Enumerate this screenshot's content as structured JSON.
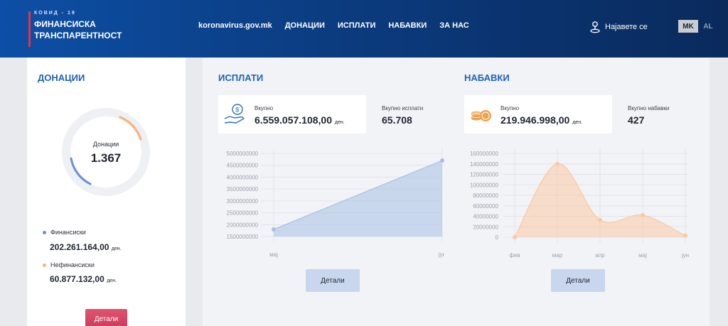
{
  "brand": {
    "subtitle": "КОВИД - 19",
    "line1": "ФИНАНСИСКА",
    "line2": "ТРАНСПАРЕНТНОСТ"
  },
  "nav": [
    {
      "label": "koronavirus.gov.mk"
    },
    {
      "label": "ДОНАЦИИ"
    },
    {
      "label": "ИСПЛАТИ"
    },
    {
      "label": "НАБАВКИ"
    },
    {
      "label": "ЗА НАС"
    }
  ],
  "login": {
    "label": "Најавете се",
    "icon": "user-pin-icon"
  },
  "languages": [
    {
      "code": "MK",
      "active": true
    },
    {
      "code": "AL",
      "active": false
    }
  ],
  "donations": {
    "title": "ДОНАЦИИ",
    "center_label": "Донации",
    "center_value": "1.367",
    "legend": [
      {
        "label": "Финансиски",
        "amount": "202.261.164,00",
        "currency": "ден.",
        "color": "#6a8fd6"
      },
      {
        "label": "Нефинансиски",
        "amount": "60.877.132,00",
        "currency": "ден.",
        "color": "#f7b27a"
      }
    ],
    "details_label": "Детали"
  },
  "payments": {
    "title": "ИСПЛАТИ",
    "total_label": "Вкупно",
    "total_amount": "6.559.057.108,00",
    "currency": "ден.",
    "count_label": "Вкупно исплати",
    "count_value": "65.708",
    "icon": "money-hand-icon",
    "details_label": "Детали"
  },
  "procurements": {
    "title": "НАБАВКИ",
    "total_label": "Вкупно",
    "total_amount": "219.946.998,00",
    "currency": "ден.",
    "count_label": "Вкупно набавки",
    "count_value": "427",
    "icon": "coins-icon",
    "details_label": "Детали"
  },
  "chart_data": [
    {
      "type": "area",
      "categories": [
        "мај",
        "јун"
      ],
      "values": [
        1800000000,
        4700000000
      ],
      "yticks": [
        1500000000,
        2000000000,
        2500000000,
        3000000000,
        3500000000,
        4000000000,
        4500000000,
        5000000000
      ],
      "ylim": [
        1500000000,
        5000000000
      ],
      "color": "#a8bfe3",
      "grid": true
    },
    {
      "type": "area",
      "categories": [
        "фев",
        "мар",
        "апр",
        "мај",
        "јун"
      ],
      "values": [
        0,
        140000000,
        33000000,
        42000000,
        3000000
      ],
      "yticks": [
        0,
        20000000,
        40000000,
        60000000,
        80000000,
        100000000,
        120000000,
        140000000,
        160000000
      ],
      "ylim": [
        0,
        160000000
      ],
      "color": "#f9c9a4",
      "grid": true
    }
  ]
}
